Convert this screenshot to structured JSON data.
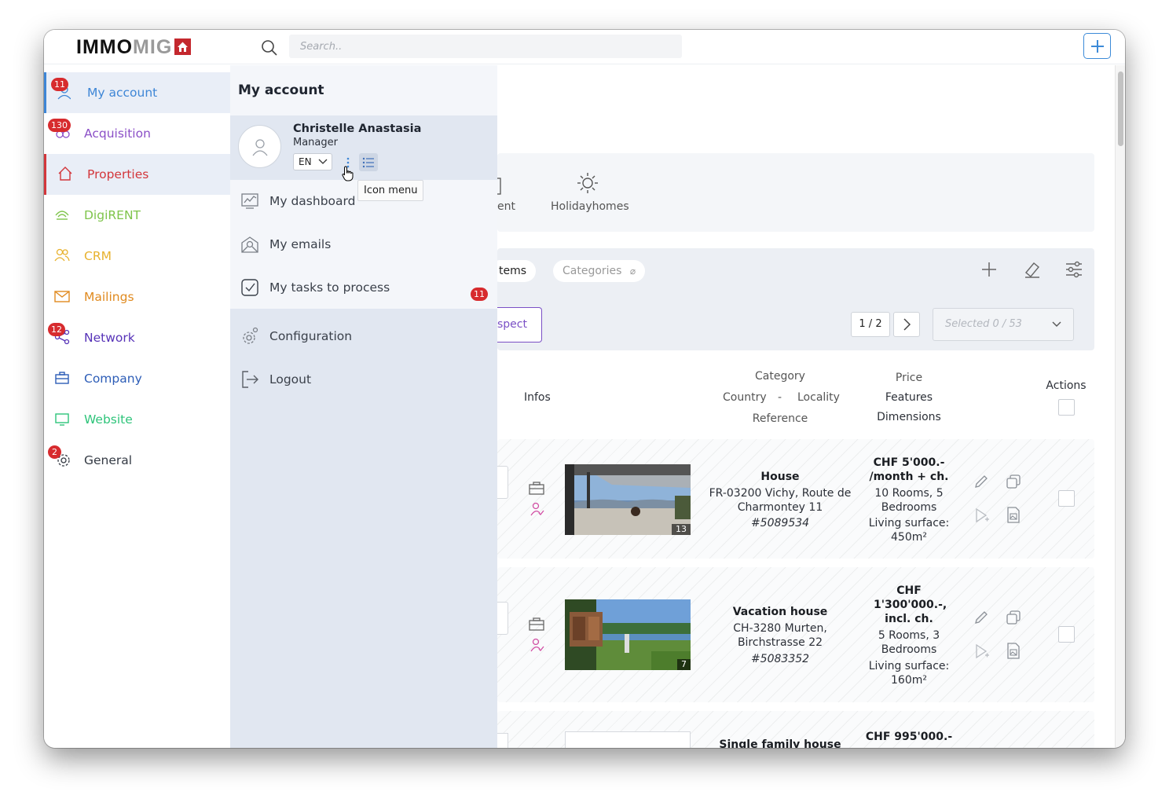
{
  "app": {
    "logo_part1": "IMMO",
    "logo_part2": "MIG"
  },
  "topbar": {
    "search_placeholder": "Search.."
  },
  "sidebar": {
    "items": [
      {
        "label": "My account",
        "badge": "11",
        "color": "#3e86d6"
      },
      {
        "label": "Acquisition",
        "badge": "130",
        "color": "#8b4fc7"
      },
      {
        "label": "Properties",
        "badge": "",
        "color": "#d3363b"
      },
      {
        "label": "DigiRENT",
        "badge": "",
        "color": "#7ec44a"
      },
      {
        "label": "CRM",
        "badge": "",
        "color": "#e8b22e"
      },
      {
        "label": "Mailings",
        "badge": "",
        "color": "#e08a1f"
      },
      {
        "label": "Network",
        "badge": "12",
        "color": "#5733b8"
      },
      {
        "label": "Company",
        "badge": "",
        "color": "#2d5db7"
      },
      {
        "label": "Website",
        "badge": "",
        "color": "#2ec47a"
      },
      {
        "label": "General",
        "badge": "2",
        "color": "#343a44"
      }
    ]
  },
  "account_panel": {
    "title": "My account",
    "user_name": "Christelle Anastasia",
    "user_role": "Manager",
    "language": "EN",
    "tooltip": "Icon menu",
    "menu": [
      {
        "label": "My dashboard",
        "icon": "dashboard-icon",
        "badge": ""
      },
      {
        "label": "My emails",
        "icon": "email-icon",
        "badge": ""
      },
      {
        "label": "My tasks to process",
        "icon": "tasks-icon",
        "badge": "11"
      },
      {
        "label": "Configuration",
        "icon": "gear-icon",
        "badge": ""
      },
      {
        "label": "Logout",
        "icon": "logout-icon",
        "badge": ""
      }
    ]
  },
  "content": {
    "type_tabs": [
      "ent",
      "Holidayhomes"
    ],
    "filters": {
      "items_chip": "tems",
      "categories_chip": "Categories",
      "prospect_btn": "spect"
    },
    "pagination": {
      "page": "1 / 2",
      "selected": "Selected 0 / 53"
    },
    "table_header": {
      "infos": "Infos",
      "category": "Category",
      "country": "Country",
      "dash": "-",
      "locality": "Locality",
      "reference": "Reference",
      "price": "Price",
      "features": "Features",
      "dimensions": "Dimensions",
      "actions": "Actions"
    },
    "rows": [
      {
        "category": "House",
        "location": "FR-03200 Vichy, Route de Charmontey 11",
        "reference": "#5089534",
        "price": "CHF 5'000.- /month + ch.",
        "features": "10 Rooms, 5 Bedrooms",
        "surface": "Living surface: 450m²",
        "photo_count": "13"
      },
      {
        "category": "Vacation house",
        "location": "CH-3280 Murten, Birchstrasse 22",
        "reference": "#5083352",
        "price": "CHF 1'300'000.-, incl. ch.",
        "features": "5 Rooms, 3 Bedrooms",
        "surface": "Living surface: 160m²",
        "photo_count": "7"
      },
      {
        "category": "Single family house",
        "price": "CHF 995'000.-"
      }
    ]
  }
}
